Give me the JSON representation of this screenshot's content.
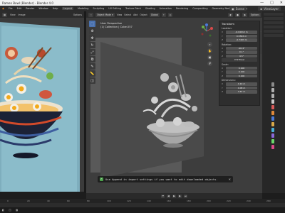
{
  "window": {
    "title": "Ramen Bowl (Blender) - Blender 4.0",
    "controls": [
      "—",
      "□",
      "✕"
    ]
  },
  "menubar": {
    "items": [
      "File",
      "Edit",
      "Render",
      "Window",
      "Help"
    ],
    "tabs": [
      "Layout",
      "Modeling",
      "Sculpting",
      "UV Editing",
      "Texture Paint",
      "Shading",
      "Animation",
      "Rendering",
      "Compositing",
      "Geometry Nodes",
      "Scripting"
    ],
    "active_tab": "Layout",
    "scene": "Scene",
    "view_layer": "ViewLayer"
  },
  "left_editor": {
    "menus": [
      "View",
      "Image"
    ],
    "options_label": "Options"
  },
  "viewport": {
    "mode": "Object Mode",
    "menus": [
      "View",
      "Select",
      "Add",
      "Object"
    ],
    "transform": "Global",
    "options_label": "Options",
    "info_line1": "User Perspective",
    "info_line2": "(1) Collection | Cube.057",
    "notice": "Use Append in import settings if you want to edit downloaded objects."
  },
  "npanel": {
    "header": "Transform",
    "location_label": "Location:",
    "location": [
      "-0.04012 m",
      "0.5583 m",
      "-0.7403 m"
    ],
    "rotation_label": "Rotation:",
    "rotation": [
      "-90.4°",
      "0.1°",
      "4.5°"
    ],
    "mode": "XYZ Euler",
    "scale_label": "Scale:",
    "scale": [
      "0.100",
      "0.100",
      "0.100"
    ],
    "dimensions_label": "Dimensions:",
    "dimensions": [
      "4.19 m",
      "4.08 m",
      "3.67 m"
    ],
    "axes": [
      "X",
      "Y",
      "Z"
    ]
  },
  "timeline": {
    "ticks": [
      "0",
      "20",
      "40",
      "60",
      "80",
      "100",
      "120",
      "140",
      "160",
      "180",
      "200",
      "220",
      "240",
      "260"
    ]
  },
  "colors": {
    "accent": "#4a72b0",
    "success": "#4ba24b"
  }
}
